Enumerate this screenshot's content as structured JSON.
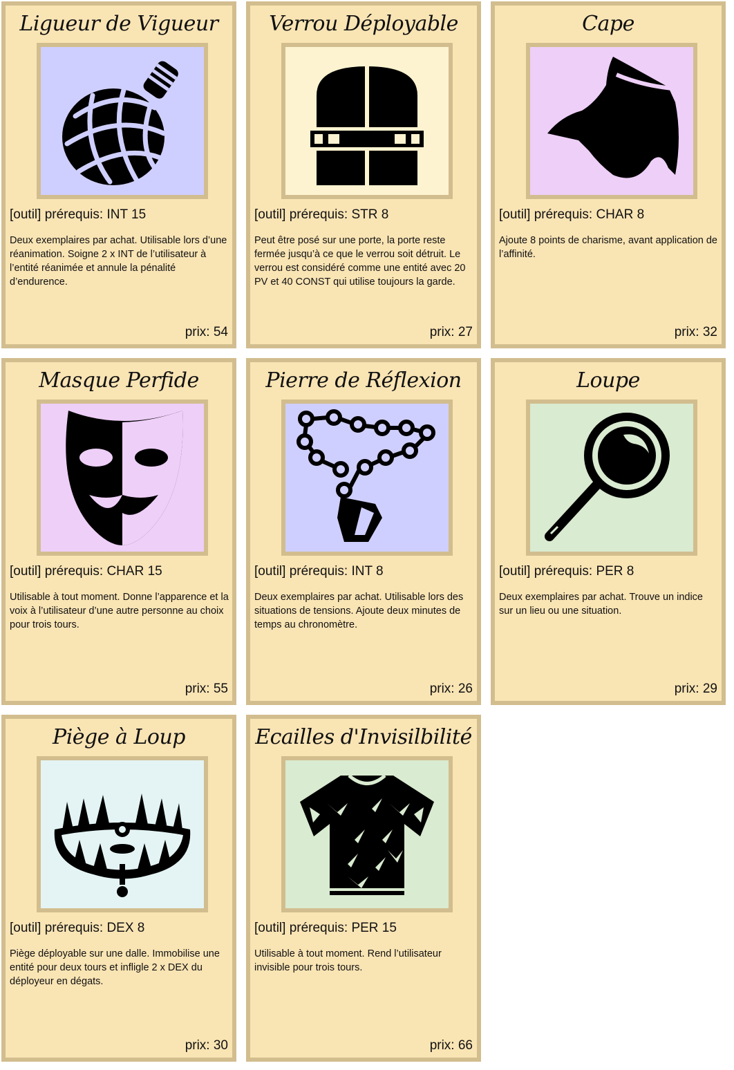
{
  "cards": [
    {
      "title": "Ligueur de Vigueur",
      "art_bg": "#cfcfff",
      "icon": "potion-icon",
      "requirement": "[outil] prérequis: INT 15",
      "description": "Deux exemplaires par achat. Utilisable lors d’une réanimation. Soigne 2 x INT de l’utilisateur à l’entité réanimée et annule la pénalité d’endurence.",
      "price": "prix: 54"
    },
    {
      "title": "Verrou Déployable",
      "art_bg": "#fdf3d0",
      "icon": "lock-door-icon",
      "requirement": "[outil] prérequis: STR 8",
      "description": "Peut être posé sur une porte, la porte reste fermée jusqu’à ce que le verrou soit détruit. Le verrou est considéré comme une entité avec 20 PV et 40 CONST qui utilise toujours la garde.",
      "price": "prix: 27"
    },
    {
      "title": "Cape",
      "art_bg": "#eecff8",
      "icon": "cape-icon",
      "requirement": "[outil] prérequis: CHAR 8",
      "description": "Ajoute 8 points de charisme, avant application de l’affinité.",
      "price": "prix: 32"
    },
    {
      "title": "Masque Perfide",
      "art_bg": "#eecff8",
      "icon": "mask-icon",
      "requirement": "[outil] prérequis: CHAR 15",
      "description": "Utilisable à tout moment. Donne l’apparence et la voix à l’utilisateur d’une autre personne au choix pour trois tours.",
      "price": "prix: 55"
    },
    {
      "title": "Pierre de Réflexion",
      "art_bg": "#cfcfff",
      "icon": "pendant-icon",
      "requirement": "[outil] prérequis: INT 8",
      "description": "Deux exemplaires par achat. Utilisable lors des situations de tensions. Ajoute deux minutes de temps au chronomètre.",
      "price": "prix: 26"
    },
    {
      "title": "Loupe",
      "art_bg": "#d9ebd0",
      "icon": "magnifier-icon",
      "requirement": "[outil] prérequis: PER 8",
      "description": "Deux exemplaires par achat. Trouve un indice sur un lieu ou une situation.",
      "price": "prix: 29"
    },
    {
      "title": "Piège à Loup",
      "art_bg": "#e4f4f4",
      "icon": "bear-trap-icon",
      "requirement": "[outil] prérequis: DEX 8",
      "description": "Piège déployable sur une dalle. Immobilise une entité pour deux tours et infligle 2 x DEX du déployeur en dégats.",
      "price": "prix: 30"
    },
    {
      "title": "Ecailles d'Invisilbilité",
      "art_bg": "#d9ebd0",
      "icon": "scale-shirt-icon",
      "requirement": "[outil] prérequis: PER 15",
      "description": "Utilisable à tout moment. Rend l’utilisateur invisible pour trois tours.",
      "price": "prix: 66"
    }
  ]
}
